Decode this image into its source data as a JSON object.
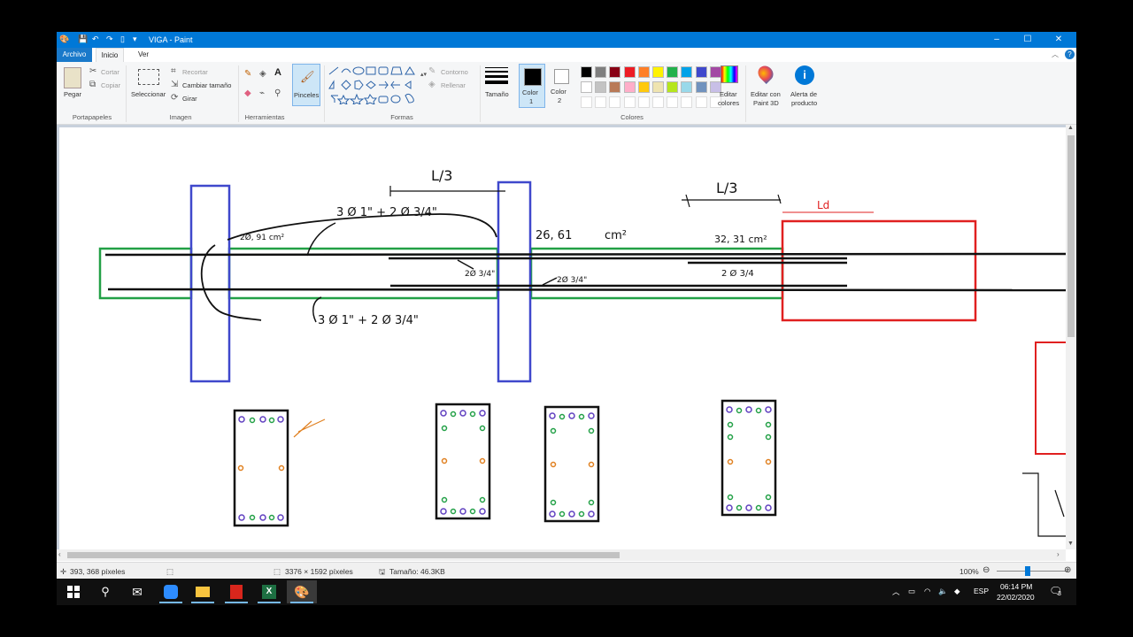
{
  "window": {
    "title": "VIGA - Paint",
    "controls": {
      "minimize": "–",
      "maximize": "☐",
      "close": "✕"
    }
  },
  "tabs": {
    "file": "Archivo",
    "home": "Inicio",
    "view": "Ver"
  },
  "ribbon": {
    "clipboard": {
      "paste": "Pegar",
      "cut": "Cortar",
      "copy": "Copiar",
      "group": "Portapapeles"
    },
    "image": {
      "select": "Seleccionar",
      "crop": "Recortar",
      "resize": "Cambiar tamaño",
      "rotate": "Girar",
      "group": "Imagen"
    },
    "tools": {
      "group": "Herramientas",
      "text_icon": "A"
    },
    "brushes": {
      "label": "Pinceles"
    },
    "shapes": {
      "outline": "Contorno",
      "fill": "Rellenar",
      "group": "Formas"
    },
    "size": {
      "label": "Tamaño"
    },
    "colors": {
      "color1_line1": "Color",
      "color1_line2": "1",
      "color2_line1": "Color",
      "color2_line2": "2",
      "group": "Colores",
      "edit_line1": "Editar",
      "edit_line2": "colores",
      "palette_row1": [
        "#000000",
        "#7f7f7f",
        "#880015",
        "#ed1c24",
        "#ff7f27",
        "#fff200",
        "#22b14c",
        "#00a2e8",
        "#3f48cc",
        "#a349a4"
      ],
      "palette_row2": [
        "#ffffff",
        "#c3c3c3",
        "#b97a57",
        "#ffaec9",
        "#ffc90e",
        "#efe4b0",
        "#b5e61d",
        "#99d9ea",
        "#7092be",
        "#c8bfe7"
      ]
    },
    "paint3d": {
      "line1": "Editar con",
      "line2": "Paint 3D"
    },
    "alert": {
      "line1": "Alerta de",
      "line2": "producto"
    }
  },
  "drawing": {
    "top_label_1": "L/3",
    "top_label_2": "L/3",
    "top_label_3": "Ld",
    "rebar_top": "3 Ø 1\" + 2 Ø 3/4\"",
    "rebar_bottom": "3 Ø 1\" + 2 Ø 3/4\"",
    "area_left": "2Ø, 91 cm²",
    "area_mid": "26, 61",
    "area_mid_unit": "cm²",
    "area_right": "32, 31 cm²",
    "bar_mid_1": "2Ø 3/4\"",
    "bar_mid_2": "2Ø 3/4\"",
    "bar_right": "2 Ø 3/4"
  },
  "status": {
    "cursor": "393, 368 píxeles",
    "dimensions": "3376 × 1592 píxeles",
    "size": "Tamaño: 46.3KB",
    "zoom": "100%"
  },
  "taskbar": {
    "lang": "ESP",
    "time": "06:14 PM",
    "date": "22/02/2020",
    "notif_count": "3"
  }
}
